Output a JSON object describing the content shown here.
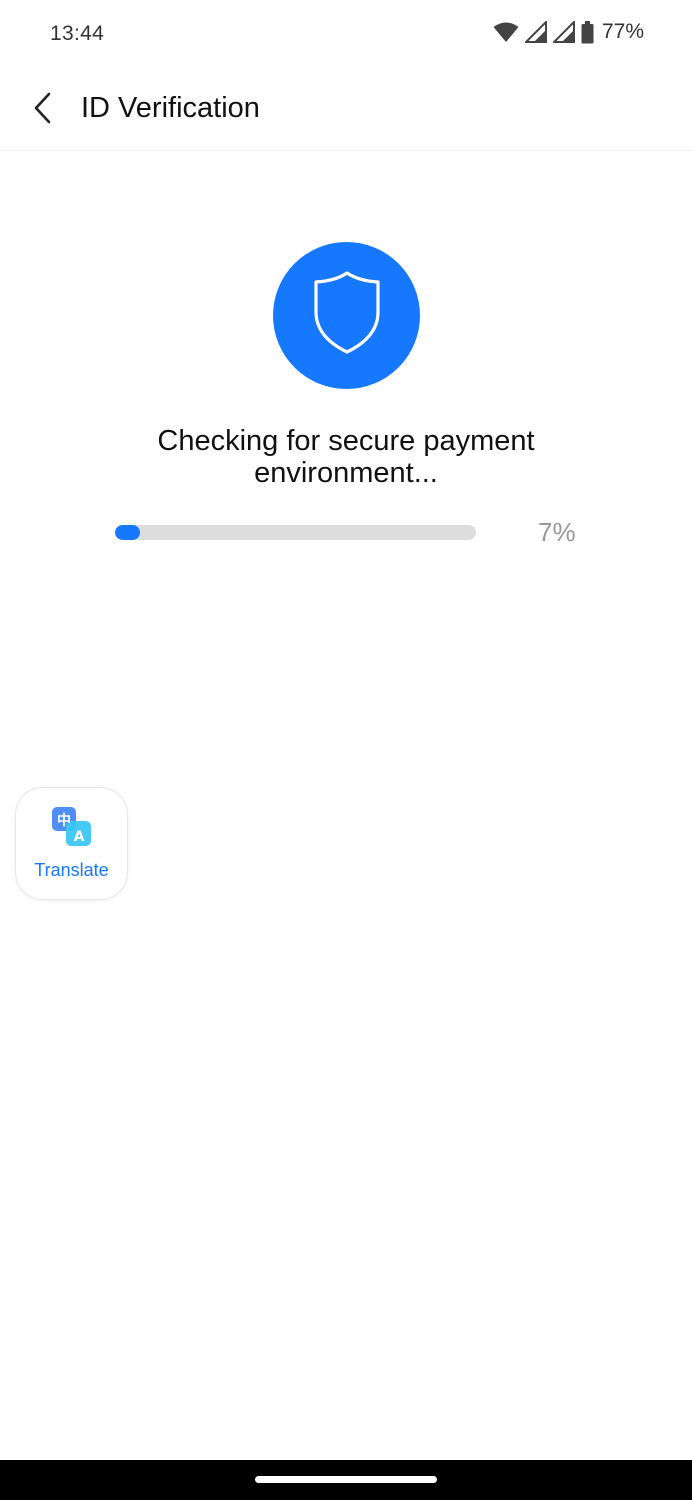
{
  "status_bar": {
    "time": "13:44",
    "battery_percent": "77%",
    "icons": [
      "wifi-icon",
      "signal-icon",
      "signal-icon",
      "battery-icon"
    ]
  },
  "header": {
    "back_icon": "chevron-left-icon",
    "title": "ID Verification"
  },
  "main": {
    "status_icon": "shield-icon",
    "message": "Checking for secure payment environment...",
    "progress": {
      "value": 0.07,
      "label": "7%"
    }
  },
  "translate_button": {
    "icon": "translate-icon",
    "label": "Translate"
  },
  "colors": {
    "accent": "#1677ff",
    "track": "#dddddd",
    "muted_text": "#999999",
    "background": "#ffffff",
    "nav_bar": "#000000"
  }
}
